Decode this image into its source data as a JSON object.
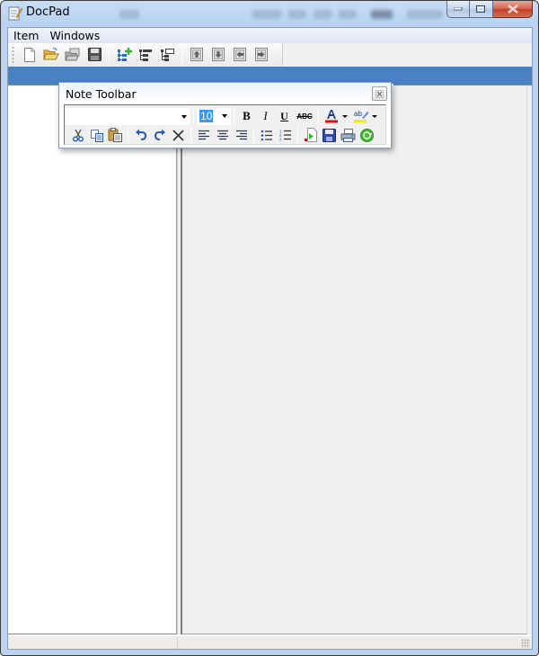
{
  "window": {
    "title": "DocPad",
    "caption_buttons": [
      "minimize",
      "maximize",
      "close"
    ]
  },
  "menubar": {
    "items": [
      {
        "label": "Item"
      },
      {
        "label": "Windows"
      }
    ]
  },
  "main_toolbar": {
    "groups": [
      [
        {
          "name": "new-document",
          "icon": "new-document-icon"
        },
        {
          "name": "open-folder",
          "icon": "open-folder-icon"
        },
        {
          "name": "open-recent",
          "icon": "open-recent-icon"
        },
        {
          "name": "save",
          "icon": "save-disk-icon"
        }
      ],
      [
        {
          "name": "add-node",
          "icon": "tree-add-icon"
        },
        {
          "name": "tree-node",
          "icon": "tree-node-icon"
        },
        {
          "name": "tree-node-alt",
          "icon": "tree-node-alt-icon"
        }
      ],
      [
        {
          "name": "move-up",
          "icon": "arrow-up-icon"
        },
        {
          "name": "move-down",
          "icon": "arrow-down-icon"
        },
        {
          "name": "move-left",
          "icon": "arrow-left-icon"
        },
        {
          "name": "move-right",
          "icon": "arrow-right-icon"
        }
      ]
    ]
  },
  "note_toolbar": {
    "title": "Note Toolbar",
    "font_name": "",
    "font_size": "10",
    "format_buttons": {
      "bold": "B",
      "italic": "I",
      "underline": "U",
      "strikethrough": "ABC"
    },
    "colors": {
      "font_color": "#e01010",
      "highlight_color": "#f5f000",
      "accent": "#3399ff"
    }
  },
  "statusbar": {
    "left_text": "",
    "right_text": ""
  },
  "colors": {
    "band": "#4a81c4",
    "titlebar": "#b9d3f1"
  }
}
